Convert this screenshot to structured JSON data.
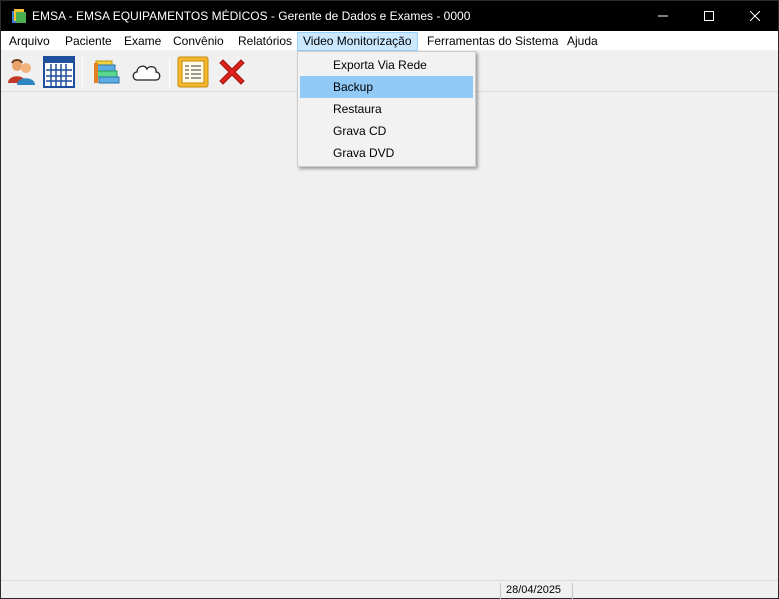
{
  "window": {
    "title": "EMSA - EMSA EQUIPAMENTOS MÉDICOS - Gerente de Dados e Exames - 0000"
  },
  "menubar": {
    "items": [
      {
        "label": "Arquivo"
      },
      {
        "label": "Paciente"
      },
      {
        "label": "Exame"
      },
      {
        "label": "Convênio"
      },
      {
        "label": "Relatórios"
      },
      {
        "label": "Video Monitorização"
      },
      {
        "label": "Ferramentas do Sistema"
      },
      {
        "label": "Ajuda"
      }
    ],
    "active": "Video Monitorização"
  },
  "dropdown": {
    "items": [
      {
        "label": "Exporta Via Rede"
      },
      {
        "label": "Backup"
      },
      {
        "label": "Restaura"
      },
      {
        "label": "Grava CD"
      },
      {
        "label": "Grava DVD"
      }
    ],
    "highlighted": "Backup"
  },
  "toolbar": {
    "icons": [
      "patients-icon",
      "calendar-grid-icon",
      "stacked-folders-icon",
      "cloud-icon",
      "report-list-icon",
      "exit-x-icon"
    ]
  },
  "statusbar": {
    "date": "28/04/2025"
  },
  "colors": {
    "titlebar_bg": "#000000",
    "menu_active_bg": "#cce8ff",
    "dropdown_highlight": "#91c9f7",
    "exit_red": "#e0201a"
  }
}
